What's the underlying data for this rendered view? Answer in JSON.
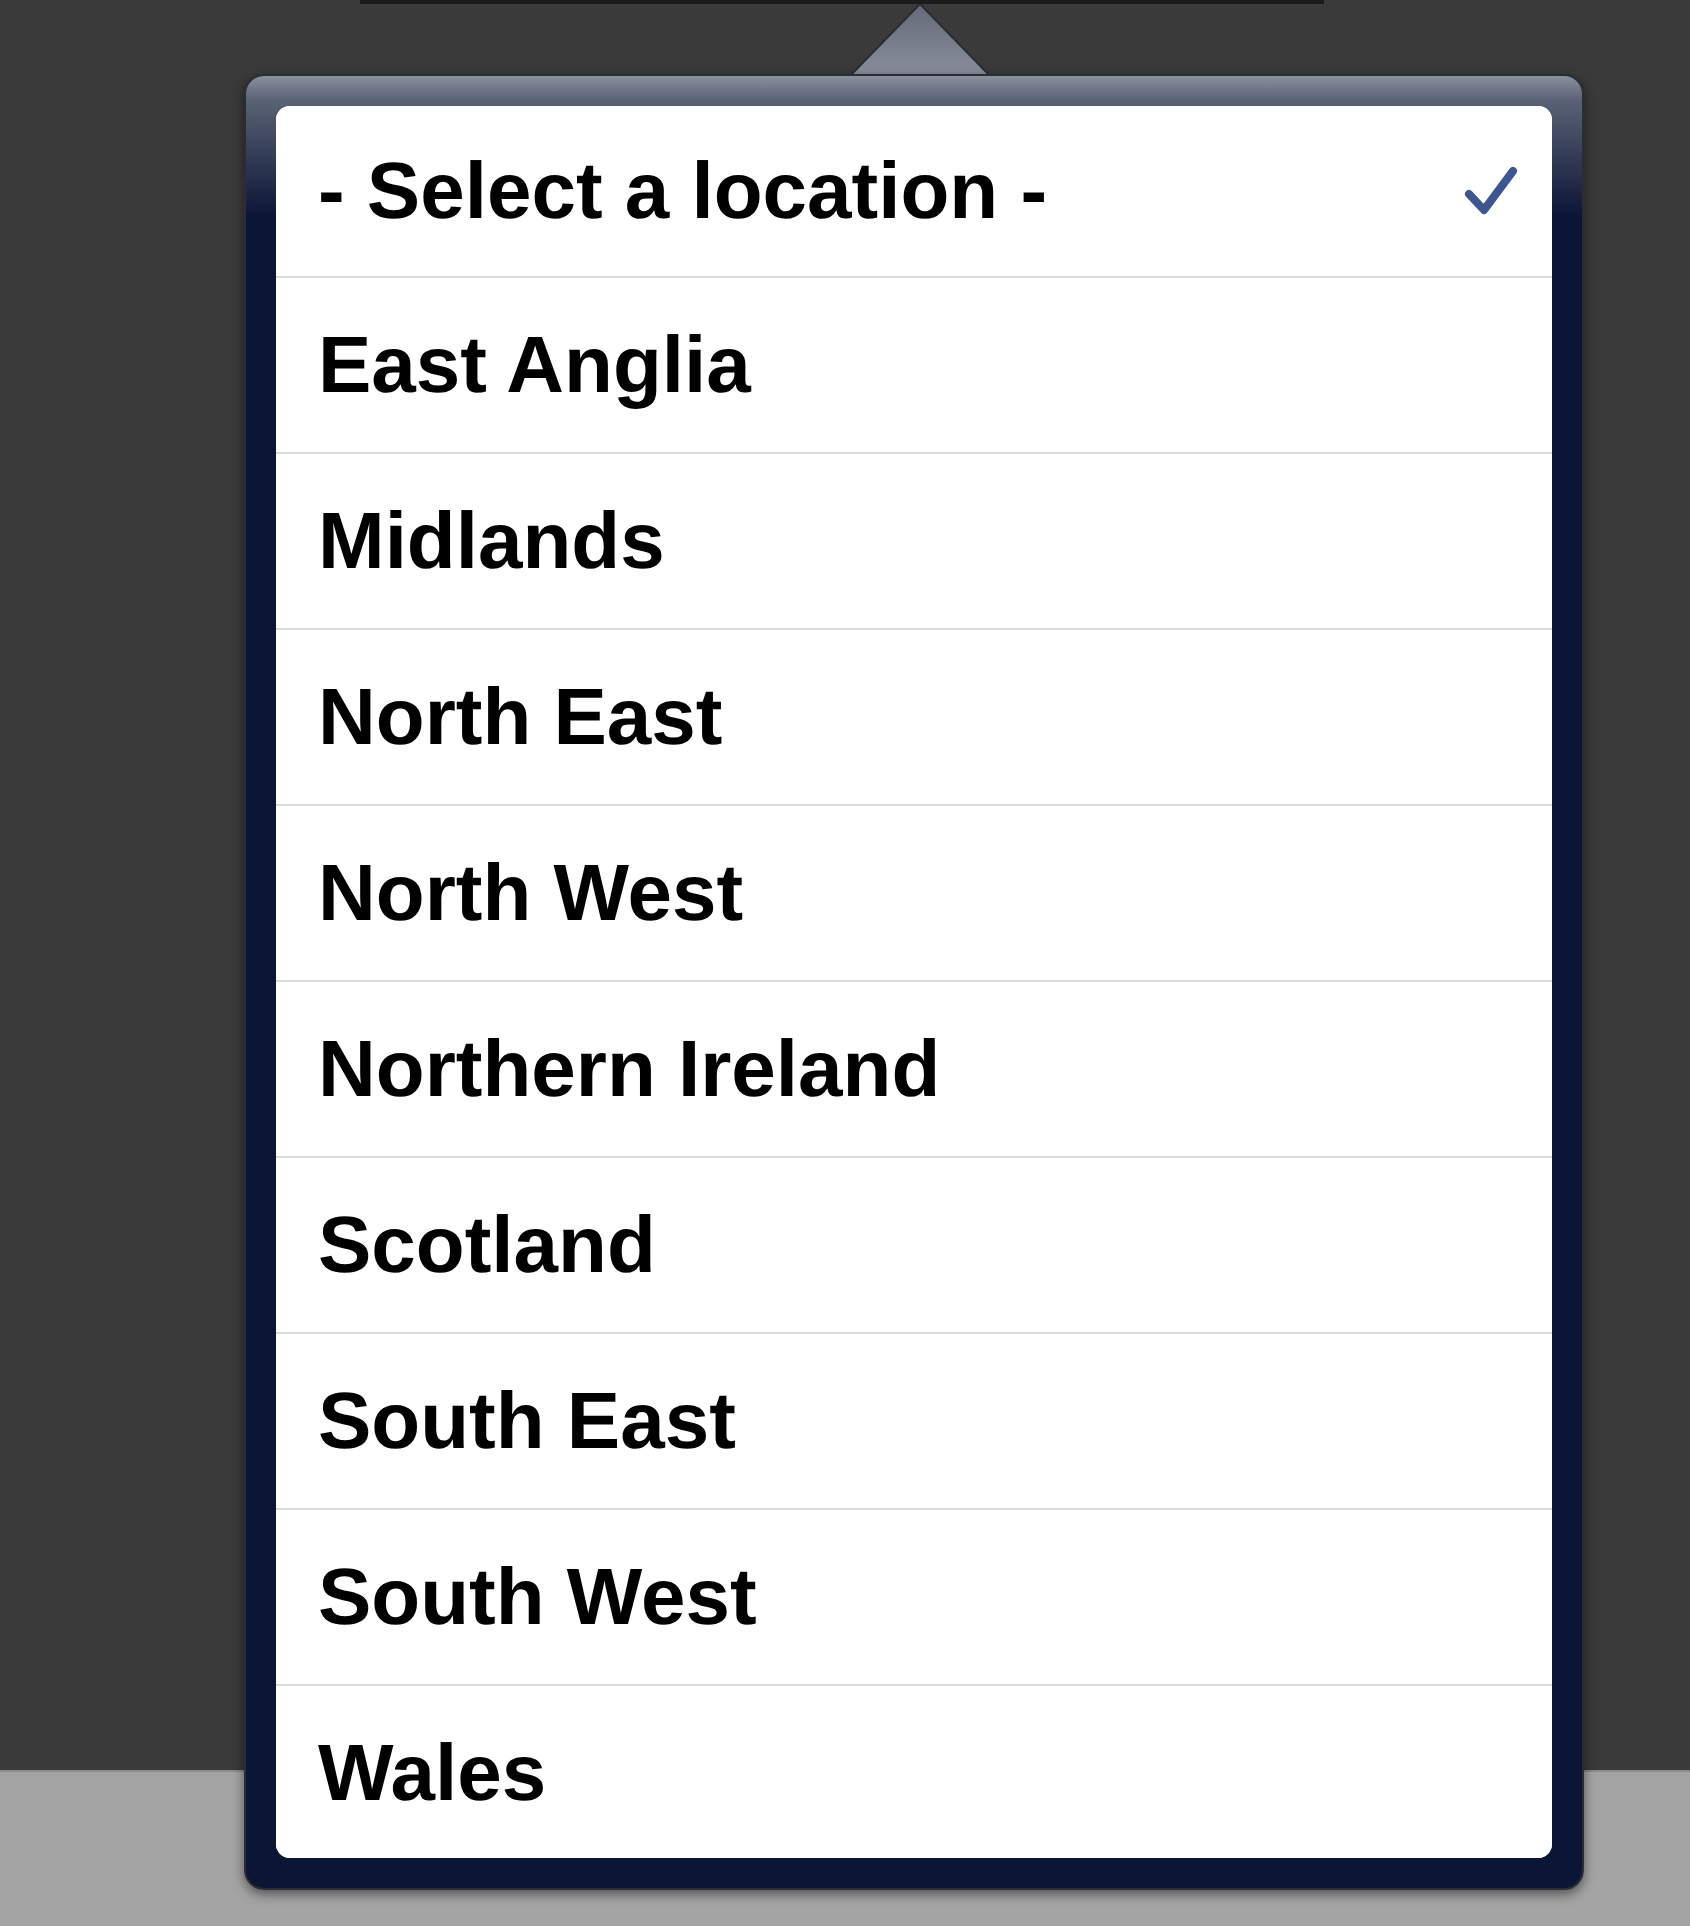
{
  "popover": {
    "items": [
      {
        "label": "- Select a location -",
        "selected": true
      },
      {
        "label": "East Anglia",
        "selected": false
      },
      {
        "label": "Midlands",
        "selected": false
      },
      {
        "label": "North East",
        "selected": false
      },
      {
        "label": "North West",
        "selected": false
      },
      {
        "label": "Northern Ireland",
        "selected": false
      },
      {
        "label": "Scotland",
        "selected": false
      },
      {
        "label": "South East",
        "selected": false
      },
      {
        "label": "South West",
        "selected": false
      },
      {
        "label": "Wales",
        "selected": false
      }
    ]
  }
}
